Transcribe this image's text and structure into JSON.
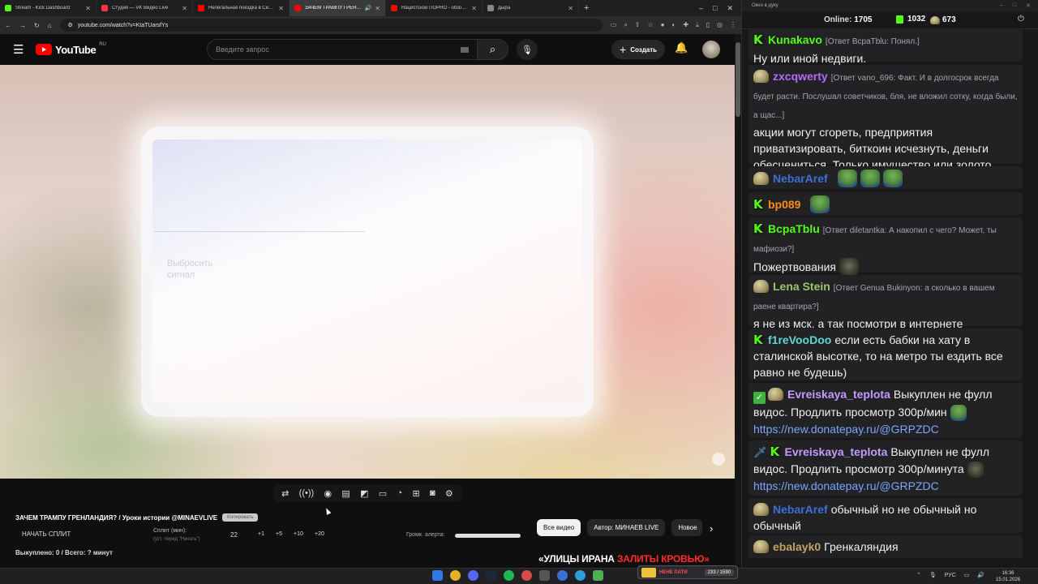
{
  "browser": {
    "tabs": [
      {
        "title": "Stream - Kick Dashboard",
        "favicon_color": "#53fc18",
        "active": false
      },
      {
        "title": "Студия — VK Видео Live",
        "favicon_color": "#ff3347",
        "active": false
      },
      {
        "title": "Нелегальная поездка в Сирию",
        "favicon_color": "#ff0000",
        "active": false
      },
      {
        "title": "ЗАЧЕМ ТРАМПУ ГРЕНЛАНДИЯ",
        "favicon_color": "#ff0000",
        "active": true,
        "sound": true
      },
      {
        "title": "Нацистское ПОРНО - обзор из...",
        "favicon_color": "#ff0000",
        "active": false
      },
      {
        "title": "Дыра",
        "favicon_color": "#888888",
        "active": false
      }
    ],
    "new_tab_label": "+",
    "window_controls": [
      "–",
      "□",
      "✕"
    ],
    "url": "youtube.com/watch?v=KtaTUarsfYs"
  },
  "youtube": {
    "logo_text": "YouTube",
    "logo_region": "RU",
    "search_placeholder": "Введите запрос",
    "create_label": "Создать"
  },
  "video": {
    "blurred_text": "Выбросить сигнал"
  },
  "controls": {
    "title": "ЗАЧЕМ ТРАМПУ ГРЕНЛАНДИЯ? / Уроки истории @MINAEVLIVE",
    "badge": "Копировать",
    "start_split": "НАЧАТЬ СПЛИТ",
    "split_label": "Сплит (мин):",
    "split_hint": "(уст. перед \"Начать\")",
    "split_value": "22",
    "increments": [
      "+1",
      "+5",
      "+10",
      "+20"
    ],
    "bought": "Выкуплено: 0 / Всего: ? минут",
    "alert_volume_label": "Громк. алерта:",
    "alert_volume": 1.0
  },
  "chips": [
    "Все видео",
    "Автор: МИНАЕВ LIVE",
    "Новое"
  ],
  "headline": {
    "part1": "«УЛИЦЫ ИРАНА ",
    "part2": "ЗАЛИТЫ КРОВЬЮ»"
  },
  "chat": {
    "window_title": "Окно в дуку",
    "online_label": "Online:",
    "online": "1705",
    "kick_count": "1032",
    "other_count": "673",
    "messages": [
      {
        "nick": "Kunakavo",
        "color": "#53fc18",
        "badge": "kick",
        "reply": "[Ответ BcpaTblu: Понял.]",
        "text": "Ну или иной недвиги."
      },
      {
        "nick": "zxcqwerty",
        "color": "#b36bff",
        "badge": "pepe",
        "reply": "[Ответ vano_696: Факт. И в долгосрок всегда будет расти. Послушал советчиков, бля, не вложил сотку, когда были, а щас...]",
        "text": "акции могут сгореть, предприятия приватизировать, биткоин исчезнуть, деньги обесцениться. Только имущество или золото"
      },
      {
        "nick": "NebarAref",
        "color": "#3c6fd9",
        "badge": "pepe",
        "reply": "",
        "text": ""
      },
      {
        "nick": "bp089",
        "color": "#ff8c1a",
        "badge": "kick",
        "reply": "",
        "text": ""
      },
      {
        "nick": "BcpaTblu",
        "color": "#53fc18",
        "badge": "kick",
        "reply": "[Ответ diletantka: А накопил с чего? Может, ты мафиози?]",
        "text": "Пожертвования"
      },
      {
        "nick": "Lena Stein",
        "color": "#9bc46a",
        "badge": "pepe",
        "reply": "[Ответ Genua Bukinyon: а сколько в вашем раене квартира?]",
        "text": "я не из мск. а так посмотри в интернете"
      },
      {
        "nick": "f1reVooDoo",
        "color": "#5fd7d7",
        "badge": "kick",
        "reply": "",
        "text": "если есть бабки на хату в сталинской высотке, то на метро ты ездить все равно не будешь)"
      },
      {
        "nick": "Evreiskaya_teplota",
        "color": "#c39bff",
        "badge": "check",
        "reply": "",
        "text": "Выкуплен не фулл видос. Продлить просмотр 300р/мин",
        "link": "https://new.donatepay.ru/@GRPZDC"
      },
      {
        "nick": "Evreiskaya_teplota",
        "color": "#c39bff",
        "badge": "sword",
        "reply": "",
        "text": "Выкуплен не фулл видос. Продлить просмотр 300р/минута",
        "link": "https://new.donatepay.ru/@GRPZDC"
      },
      {
        "nick": "NebarAref",
        "color": "#3c6fd9",
        "badge": "pepe",
        "reply": "",
        "text": "обычный но не обычный но обычный"
      },
      {
        "nick": "ebalayk0",
        "color": "#c4a060",
        "badge": "pepe",
        "reply": "",
        "text": "Гренкаляндия"
      }
    ]
  },
  "taskbar": {
    "lang": "РУС",
    "time": "16:36",
    "date": "15.01.2026",
    "widget_text": "НЕНЕ ПАТИ",
    "widget_value": "233 / 1590"
  }
}
